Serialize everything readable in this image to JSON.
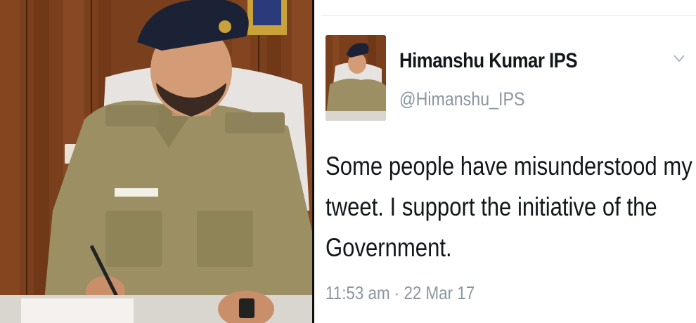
{
  "tweet": {
    "display_name": "Himanshu Kumar IPS",
    "handle": "@Himanshu_IPS",
    "text_lines": [
      "Some people have misunderstood my",
      "tweet. I support the initiative of the",
      "Government."
    ],
    "time": "11:53 am",
    "separator": "·",
    "date": "22 Mar 17",
    "menu_icon": "chevron-down-icon"
  },
  "colors": {
    "text_primary": "#14171a",
    "text_secondary": "#8a96a0",
    "divider": "#e1e8ed",
    "uniform": "#9b8f63",
    "wood_panel": "#7a3f1c",
    "beret": "#1b2236"
  }
}
